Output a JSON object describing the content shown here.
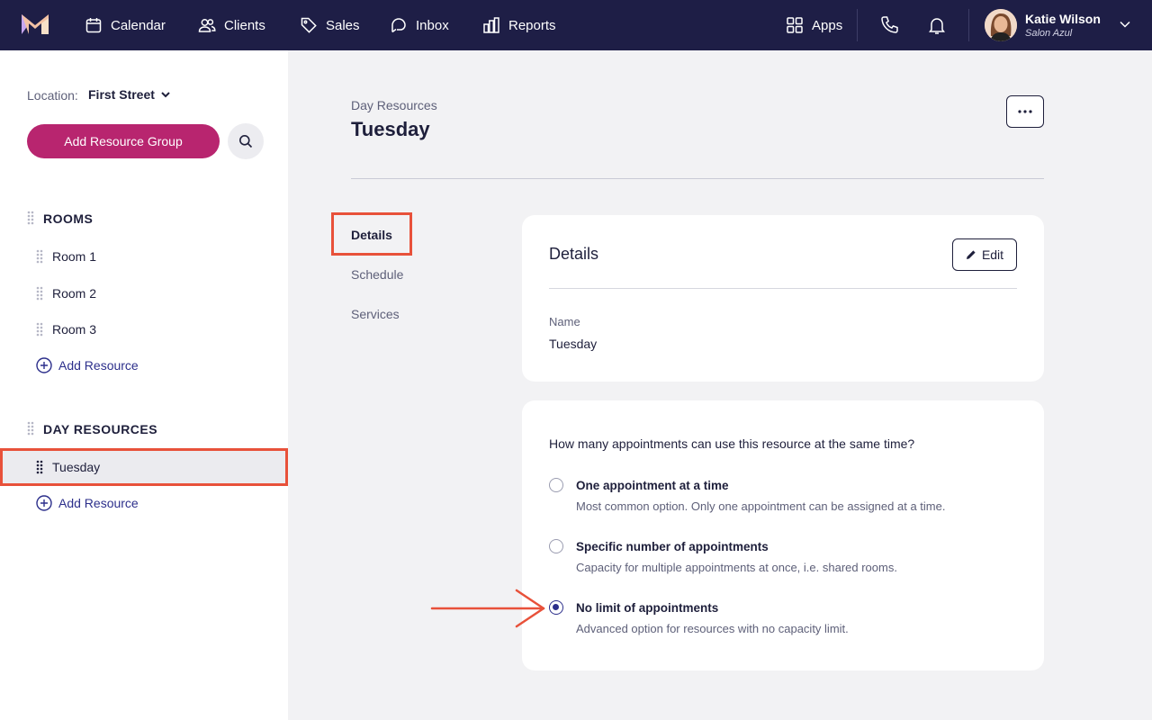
{
  "topbar": {
    "nav": [
      {
        "label": "Calendar",
        "icon": "calendar-icon"
      },
      {
        "label": "Clients",
        "icon": "clients-icon"
      },
      {
        "label": "Sales",
        "icon": "tag-icon"
      },
      {
        "label": "Inbox",
        "icon": "inbox-icon"
      },
      {
        "label": "Reports",
        "icon": "bar-chart-icon"
      }
    ],
    "apps_label": "Apps",
    "user": {
      "name": "Katie Wilson",
      "salon": "Salon Azul"
    }
  },
  "sidebar": {
    "location_label": "Location:",
    "location_value": "First Street",
    "add_group_label": "Add Resource Group",
    "groups": [
      {
        "title": "ROOMS",
        "items": [
          "Room 1",
          "Room 2",
          "Room 3"
        ],
        "add_label": "Add Resource"
      },
      {
        "title": "DAY RESOURCES",
        "items": [
          "Tuesday"
        ],
        "add_label": "Add Resource"
      }
    ]
  },
  "main": {
    "breadcrumb": "Day Resources",
    "title": "Tuesday",
    "tabs": [
      "Details",
      "Schedule",
      "Services"
    ],
    "details_card": {
      "title": "Details",
      "edit_label": "Edit",
      "name_label": "Name",
      "name_value": "Tuesday"
    },
    "capacity_card": {
      "question": "How many appointments can use this resource at the same time?",
      "options": [
        {
          "title": "One appointment at a time",
          "desc": "Most common option. Only one appointment can be assigned at a time.",
          "checked": false
        },
        {
          "title": "Specific number of appointments",
          "desc": "Capacity for multiple appointments at once, i.e. shared rooms.",
          "checked": false
        },
        {
          "title": "No limit of appointments",
          "desc": "Advanced option for resources with no capacity limit.",
          "checked": true
        }
      ]
    }
  },
  "colors": {
    "nav_bg": "#1e1e46",
    "accent": "#b8256f",
    "primary": "#2c2f8b",
    "highlight": "#e8513a"
  }
}
